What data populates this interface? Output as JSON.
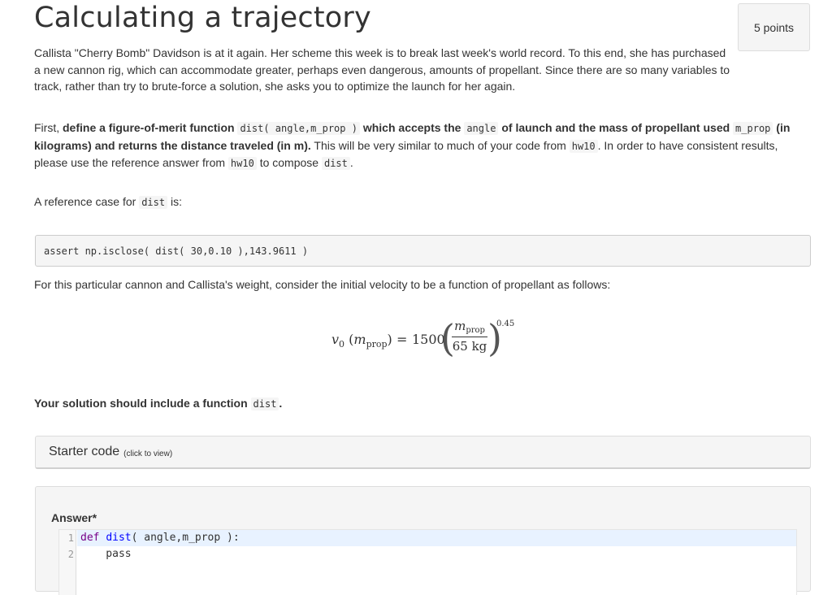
{
  "page": {
    "title": "Calculating a trajectory",
    "points": "5 points"
  },
  "intro": {
    "text": "Callista \"Cherry Bomb\" Davidson is at it again. Her scheme this week is to break last week's world record. To this end, she has purchased a new cannon rig, which can accommodate greater, perhaps even dangerous, amounts of propellant. Since there are so many variables to track, rather than try to brute-force a solution, she asks you to optimize the launch for her again."
  },
  "task": {
    "first_word": "First, ",
    "bold_1": "define a figure-of-merit function ",
    "code_dist_sig": "dist( angle,m_prop )",
    "bold_2": " which accepts the ",
    "code_angle": "angle",
    "bold_3": " of launch and the mass of propellant used ",
    "code_m_prop": "m_prop",
    "bold_4": " (in kilograms) and returns the distance traveled (in m).",
    "text_1": " This will be very similar to much of your code from ",
    "code_hw10_a": "hw10",
    "text_2": ". In order to have consistent results, please use the reference answer from ",
    "code_hw10_b": "hw10",
    "text_3": " to compose ",
    "code_dist": "dist",
    "text_4": "."
  },
  "reference": {
    "text": "A reference case for ",
    "code": "dist",
    "suffix": " is:",
    "assert_code": "assert np.isclose( dist( 30,0.10 ),143.9611 )"
  },
  "velocity": {
    "text": "For this particular cannon and Callista's weight, consider the initial velocity to be a function of propellant as follows:",
    "formula": {
      "v": "v",
      "v_sub": "0",
      "arg": "m",
      "arg_sub": "prop",
      "coefficient": "1500",
      "numerator": "m",
      "numerator_sub": "prop",
      "denominator": "65 kg",
      "exponent": "0.45"
    }
  },
  "solution": {
    "text": "Your solution should include a function ",
    "code": "dist",
    "suffix": "."
  },
  "starter": {
    "label": "Starter code",
    "hint": "(click to view)"
  },
  "answer": {
    "label": "Answer*",
    "lines": [
      {
        "num": "1",
        "kw": "def",
        "fn": "dist",
        "rest": "( angle,m_prop ):"
      },
      {
        "num": "2",
        "text": "    pass"
      }
    ]
  }
}
